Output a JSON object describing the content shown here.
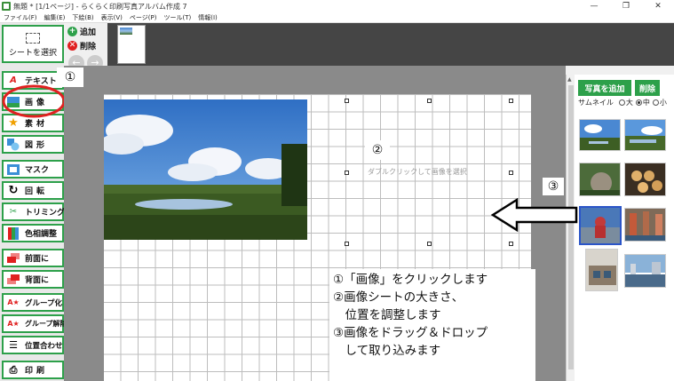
{
  "window": {
    "title": "無題 * [1/1ページ] - らくらく印刷写真アルバム作成 7",
    "minimize_glyph": "—",
    "maximize_glyph": "❐",
    "close_glyph": "✕"
  },
  "menu": [
    "ファイル(F)",
    "編集(E)",
    "下絵(B)",
    "表示(V)",
    "ページ(P)",
    "ツール(T)",
    "情報(I)"
  ],
  "toolbar": {
    "select_sheet": "シートを選択",
    "text": "テキスト",
    "image": "画像",
    "material": "素材",
    "shape": "図形",
    "mask": "マスク",
    "rotate": "回転",
    "trimming": "トリミング",
    "color_adjust": "色相調整",
    "bring_front": "前面に",
    "send_back": "背面に",
    "group": "グループ化",
    "ungroup": "グループ解除",
    "align": "位置合わせ",
    "print": "印刷"
  },
  "page_actions": {
    "add": "追加",
    "delete": "削除",
    "add_glyph": "+",
    "delete_glyph": "✕",
    "prev_glyph": "←",
    "next_glyph": "→"
  },
  "canvas": {
    "double_click_hint": "ダブルクリックして画像を選択",
    "step1": "①",
    "step2": "②",
    "step3": "③"
  },
  "instructions": [
    "①「画像」をクリックします",
    "②画像シートの大きさ、",
    "　位置を調整します",
    "③画像をドラッグ＆ドロップ",
    "　して取り込みます"
  ],
  "right_panel": {
    "add_photo": "写真を追加",
    "delete": "削除",
    "thumbnail_label": "サムネイル",
    "sizes": [
      "大",
      "中",
      "小"
    ],
    "selected_size": "中"
  },
  "colors": {
    "accent_green": "#2da04a",
    "highlight_red": "#e02020",
    "selection_blue": "#2b55c8"
  }
}
